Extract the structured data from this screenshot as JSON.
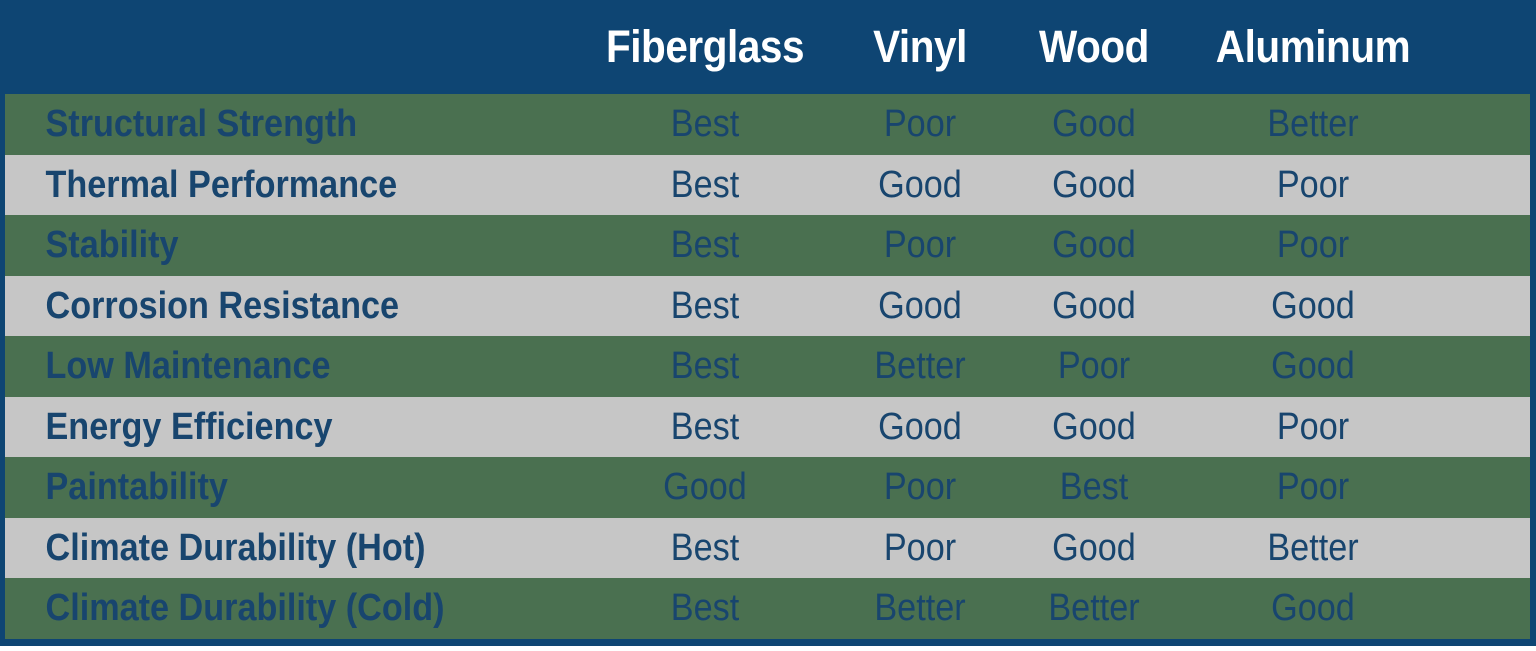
{
  "table": {
    "title_column_header": "",
    "material_columns": [
      "Fiberglass",
      "Vinyl",
      "Wood",
      "Aluminum"
    ],
    "rows": [
      {
        "label": "Structural Strength",
        "stripe": "green",
        "values": [
          "Best",
          "Poor",
          "Good",
          "Better"
        ]
      },
      {
        "label": "Thermal Performance",
        "stripe": "gray",
        "values": [
          "Best",
          "Good",
          "Good",
          "Poor"
        ]
      },
      {
        "label": "Stability",
        "stripe": "green",
        "values": [
          "Best",
          "Poor",
          "Good",
          "Poor"
        ]
      },
      {
        "label": "Corrosion Resistance",
        "stripe": "gray",
        "values": [
          "Best",
          "Good",
          "Good",
          "Good"
        ]
      },
      {
        "label": "Low Maintenance",
        "stripe": "green",
        "values": [
          "Best",
          "Better",
          "Poor",
          "Good"
        ]
      },
      {
        "label": "Energy Efficiency",
        "stripe": "gray",
        "values": [
          "Best",
          "Good",
          "Good",
          "Poor"
        ]
      },
      {
        "label": "Paintability",
        "stripe": "green",
        "values": [
          "Good",
          "Poor",
          "Best",
          "Poor"
        ]
      },
      {
        "label": "Climate Durability (Hot)",
        "stripe": "gray",
        "values": [
          "Best",
          "Poor",
          "Good",
          "Better"
        ]
      },
      {
        "label": "Climate Durability (Cold)",
        "stripe": "green",
        "values": [
          "Best",
          "Better",
          "Better",
          "Good"
        ]
      }
    ]
  },
  "colors": {
    "header_background": "#0e4573",
    "header_text": "#ffffff",
    "row_green": "#4a7050",
    "row_gray": "#c6c6c6",
    "body_text": "#18456e",
    "border": "#0e4573"
  }
}
